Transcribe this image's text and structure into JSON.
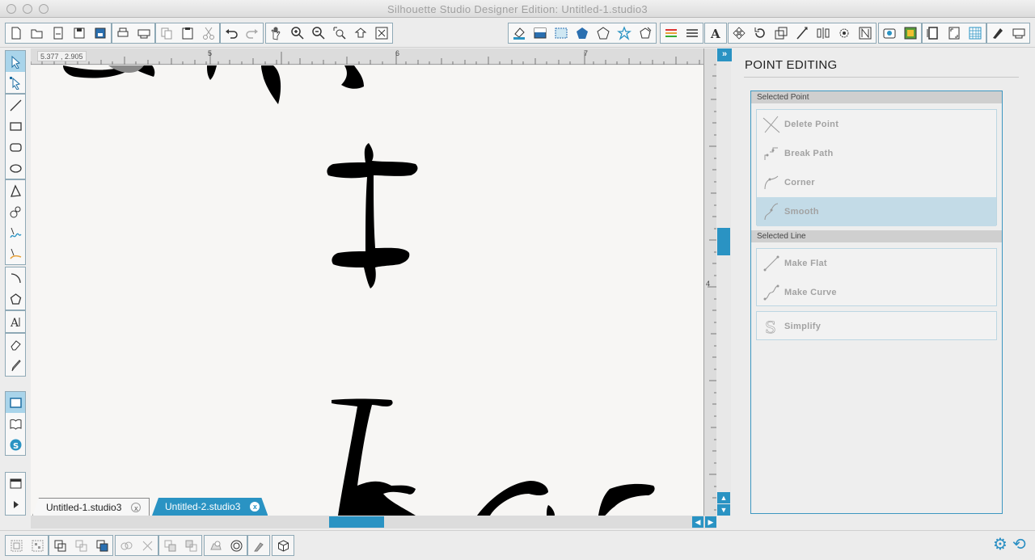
{
  "window": {
    "title": "Silhouette Studio Designer Edition: Untitled-1.studio3"
  },
  "toolbar": {
    "groups": [
      [
        "new-document-icon",
        "open-folder-icon",
        "open-file-icon",
        "save-icon",
        "save-library-icon"
      ],
      [
        "print-icon",
        "send-to-cutter-icon"
      ],
      [
        "copy-icon",
        "paste-icon",
        "cut-icon"
      ],
      [
        "undo-icon",
        "redo-icon"
      ],
      [
        "pan-hand-icon",
        "zoom-in-icon",
        "zoom-out-icon",
        "zoom-select-icon",
        "drag-zoom-icon",
        "fit-page-icon"
      ],
      [
        "fill-color-icon",
        "gradient-fill-icon",
        "pattern-fill-icon",
        "shape-fill-icon",
        "shape-outline-icon",
        "star-shape-icon",
        "shape-cog-icon"
      ],
      [
        "line-color-icon",
        "line-style-icon"
      ],
      [
        "text-style-icon"
      ],
      [
        "transform-icon",
        "rotate-icon",
        "scale-icon",
        "shear-icon",
        "align-icon",
        "replicate-icon",
        "nest-icon"
      ],
      [
        "offset-icon",
        "trace-icon"
      ],
      [
        "page-setup-icon",
        "registration-icon",
        "grid-icon"
      ],
      [
        "cut-settings-icon",
        "send-icon"
      ]
    ]
  },
  "left_tools": [
    {
      "name": "select-arrow-icon",
      "active": true
    },
    {
      "name": "point-edit-icon",
      "active": false
    },
    {
      "name": "line-tool-icon",
      "active": false
    },
    {
      "name": "rectangle-tool-icon",
      "active": false
    },
    {
      "name": "rounded-rectangle-tool-icon",
      "active": false
    },
    {
      "name": "ellipse-tool-icon",
      "active": false
    },
    {
      "name": "polygon-tool-icon",
      "active": false
    },
    {
      "name": "curve-tool-icon",
      "active": false
    },
    {
      "name": "freehand-tool-icon",
      "active": false
    },
    {
      "name": "smooth-freehand-tool-icon",
      "active": false
    },
    {
      "name": "arc-tool-icon",
      "active": false
    },
    {
      "name": "regular-polygon-tool-icon",
      "active": false
    },
    {
      "name": "text-tool-icon",
      "active": false
    },
    {
      "name": "eraser-tool-icon",
      "active": false
    },
    {
      "name": "knife-tool-icon",
      "active": false
    },
    {
      "name": "design-page-view-icon",
      "active": true
    },
    {
      "name": "library-icon",
      "active": false
    },
    {
      "name": "silhouette-store-icon",
      "active": false
    },
    {
      "name": "window-view-icon",
      "active": false
    },
    {
      "name": "play-icon",
      "active": false
    }
  ],
  "canvas": {
    "coordinates": "5.377 , 2.905",
    "ruler_labels": [
      "5",
      "6",
      "7"
    ],
    "vruler_label": "4"
  },
  "tabs": [
    {
      "label": "Untitled-1.studio3",
      "close": "x"
    },
    {
      "label": "Untitled-2.studio3",
      "close": "x"
    }
  ],
  "panel": {
    "title": "POINT EDITING",
    "collapse_label": "»",
    "selected_point": {
      "header": "Selected Point",
      "buttons": [
        {
          "label": "Delete Point",
          "icon": "delete-point-icon"
        },
        {
          "label": "Break Path",
          "icon": "break-path-icon"
        },
        {
          "label": "Corner",
          "icon": "corner-icon"
        },
        {
          "label": "Smooth",
          "icon": "smooth-icon"
        }
      ]
    },
    "selected_line": {
      "header": "Selected Line",
      "buttons": [
        {
          "label": "Make Flat",
          "icon": "make-flat-icon"
        },
        {
          "label": "Make Curve",
          "icon": "make-curve-icon"
        }
      ]
    },
    "simplify": {
      "label": "Simplify",
      "icon": "simplify-icon"
    }
  },
  "bottom_bar": {
    "groups": [
      [
        "group-icon",
        "ungroup-icon"
      ],
      [
        "make-compound-icon",
        "release-compound-icon",
        "move-front-icon"
      ],
      [
        "weld-icon",
        "subtract-icon"
      ],
      [
        "bring-forward-icon",
        "send-backward-icon"
      ],
      [
        "shape-lock-icon",
        "offset-circle-icon"
      ],
      [
        "knife-icon"
      ],
      [
        "3d-cube-icon"
      ]
    ]
  },
  "colors": {
    "accent": "#2a93c3",
    "panel_border": "#3d97c1"
  }
}
